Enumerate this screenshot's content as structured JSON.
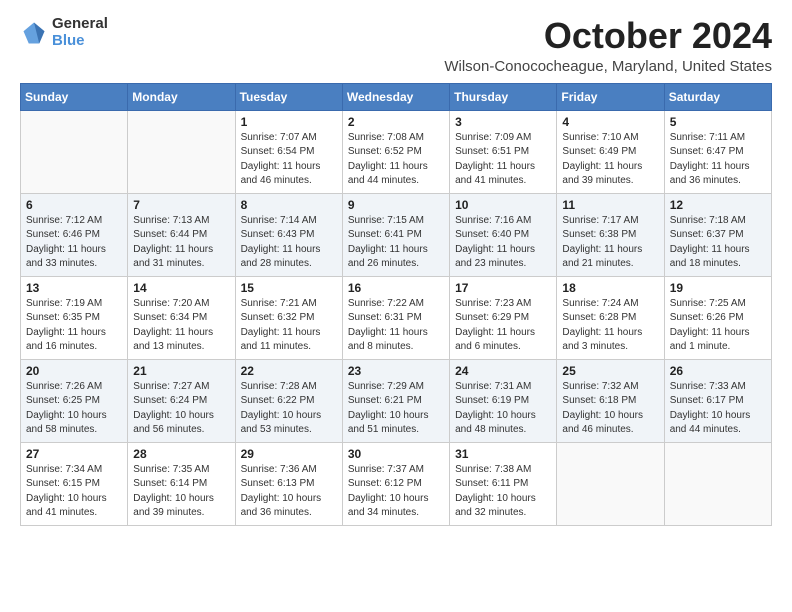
{
  "header": {
    "logo_general": "General",
    "logo_blue": "Blue",
    "month_title": "October 2024",
    "location": "Wilson-Conococheague, Maryland, United States"
  },
  "days_of_week": [
    "Sunday",
    "Monday",
    "Tuesday",
    "Wednesday",
    "Thursday",
    "Friday",
    "Saturday"
  ],
  "weeks": [
    [
      {
        "day": "",
        "sunrise": "",
        "sunset": "",
        "daylight": ""
      },
      {
        "day": "",
        "sunrise": "",
        "sunset": "",
        "daylight": ""
      },
      {
        "day": "1",
        "sunrise": "Sunrise: 7:07 AM",
        "sunset": "Sunset: 6:54 PM",
        "daylight": "Daylight: 11 hours and 46 minutes."
      },
      {
        "day": "2",
        "sunrise": "Sunrise: 7:08 AM",
        "sunset": "Sunset: 6:52 PM",
        "daylight": "Daylight: 11 hours and 44 minutes."
      },
      {
        "day": "3",
        "sunrise": "Sunrise: 7:09 AM",
        "sunset": "Sunset: 6:51 PM",
        "daylight": "Daylight: 11 hours and 41 minutes."
      },
      {
        "day": "4",
        "sunrise": "Sunrise: 7:10 AM",
        "sunset": "Sunset: 6:49 PM",
        "daylight": "Daylight: 11 hours and 39 minutes."
      },
      {
        "day": "5",
        "sunrise": "Sunrise: 7:11 AM",
        "sunset": "Sunset: 6:47 PM",
        "daylight": "Daylight: 11 hours and 36 minutes."
      }
    ],
    [
      {
        "day": "6",
        "sunrise": "Sunrise: 7:12 AM",
        "sunset": "Sunset: 6:46 PM",
        "daylight": "Daylight: 11 hours and 33 minutes."
      },
      {
        "day": "7",
        "sunrise": "Sunrise: 7:13 AM",
        "sunset": "Sunset: 6:44 PM",
        "daylight": "Daylight: 11 hours and 31 minutes."
      },
      {
        "day": "8",
        "sunrise": "Sunrise: 7:14 AM",
        "sunset": "Sunset: 6:43 PM",
        "daylight": "Daylight: 11 hours and 28 minutes."
      },
      {
        "day": "9",
        "sunrise": "Sunrise: 7:15 AM",
        "sunset": "Sunset: 6:41 PM",
        "daylight": "Daylight: 11 hours and 26 minutes."
      },
      {
        "day": "10",
        "sunrise": "Sunrise: 7:16 AM",
        "sunset": "Sunset: 6:40 PM",
        "daylight": "Daylight: 11 hours and 23 minutes."
      },
      {
        "day": "11",
        "sunrise": "Sunrise: 7:17 AM",
        "sunset": "Sunset: 6:38 PM",
        "daylight": "Daylight: 11 hours and 21 minutes."
      },
      {
        "day": "12",
        "sunrise": "Sunrise: 7:18 AM",
        "sunset": "Sunset: 6:37 PM",
        "daylight": "Daylight: 11 hours and 18 minutes."
      }
    ],
    [
      {
        "day": "13",
        "sunrise": "Sunrise: 7:19 AM",
        "sunset": "Sunset: 6:35 PM",
        "daylight": "Daylight: 11 hours and 16 minutes."
      },
      {
        "day": "14",
        "sunrise": "Sunrise: 7:20 AM",
        "sunset": "Sunset: 6:34 PM",
        "daylight": "Daylight: 11 hours and 13 minutes."
      },
      {
        "day": "15",
        "sunrise": "Sunrise: 7:21 AM",
        "sunset": "Sunset: 6:32 PM",
        "daylight": "Daylight: 11 hours and 11 minutes."
      },
      {
        "day": "16",
        "sunrise": "Sunrise: 7:22 AM",
        "sunset": "Sunset: 6:31 PM",
        "daylight": "Daylight: 11 hours and 8 minutes."
      },
      {
        "day": "17",
        "sunrise": "Sunrise: 7:23 AM",
        "sunset": "Sunset: 6:29 PM",
        "daylight": "Daylight: 11 hours and 6 minutes."
      },
      {
        "day": "18",
        "sunrise": "Sunrise: 7:24 AM",
        "sunset": "Sunset: 6:28 PM",
        "daylight": "Daylight: 11 hours and 3 minutes."
      },
      {
        "day": "19",
        "sunrise": "Sunrise: 7:25 AM",
        "sunset": "Sunset: 6:26 PM",
        "daylight": "Daylight: 11 hours and 1 minute."
      }
    ],
    [
      {
        "day": "20",
        "sunrise": "Sunrise: 7:26 AM",
        "sunset": "Sunset: 6:25 PM",
        "daylight": "Daylight: 10 hours and 58 minutes."
      },
      {
        "day": "21",
        "sunrise": "Sunrise: 7:27 AM",
        "sunset": "Sunset: 6:24 PM",
        "daylight": "Daylight: 10 hours and 56 minutes."
      },
      {
        "day": "22",
        "sunrise": "Sunrise: 7:28 AM",
        "sunset": "Sunset: 6:22 PM",
        "daylight": "Daylight: 10 hours and 53 minutes."
      },
      {
        "day": "23",
        "sunrise": "Sunrise: 7:29 AM",
        "sunset": "Sunset: 6:21 PM",
        "daylight": "Daylight: 10 hours and 51 minutes."
      },
      {
        "day": "24",
        "sunrise": "Sunrise: 7:31 AM",
        "sunset": "Sunset: 6:19 PM",
        "daylight": "Daylight: 10 hours and 48 minutes."
      },
      {
        "day": "25",
        "sunrise": "Sunrise: 7:32 AM",
        "sunset": "Sunset: 6:18 PM",
        "daylight": "Daylight: 10 hours and 46 minutes."
      },
      {
        "day": "26",
        "sunrise": "Sunrise: 7:33 AM",
        "sunset": "Sunset: 6:17 PM",
        "daylight": "Daylight: 10 hours and 44 minutes."
      }
    ],
    [
      {
        "day": "27",
        "sunrise": "Sunrise: 7:34 AM",
        "sunset": "Sunset: 6:15 PM",
        "daylight": "Daylight: 10 hours and 41 minutes."
      },
      {
        "day": "28",
        "sunrise": "Sunrise: 7:35 AM",
        "sunset": "Sunset: 6:14 PM",
        "daylight": "Daylight: 10 hours and 39 minutes."
      },
      {
        "day": "29",
        "sunrise": "Sunrise: 7:36 AM",
        "sunset": "Sunset: 6:13 PM",
        "daylight": "Daylight: 10 hours and 36 minutes."
      },
      {
        "day": "30",
        "sunrise": "Sunrise: 7:37 AM",
        "sunset": "Sunset: 6:12 PM",
        "daylight": "Daylight: 10 hours and 34 minutes."
      },
      {
        "day": "31",
        "sunrise": "Sunrise: 7:38 AM",
        "sunset": "Sunset: 6:11 PM",
        "daylight": "Daylight: 10 hours and 32 minutes."
      },
      {
        "day": "",
        "sunrise": "",
        "sunset": "",
        "daylight": ""
      },
      {
        "day": "",
        "sunrise": "",
        "sunset": "",
        "daylight": ""
      }
    ]
  ]
}
